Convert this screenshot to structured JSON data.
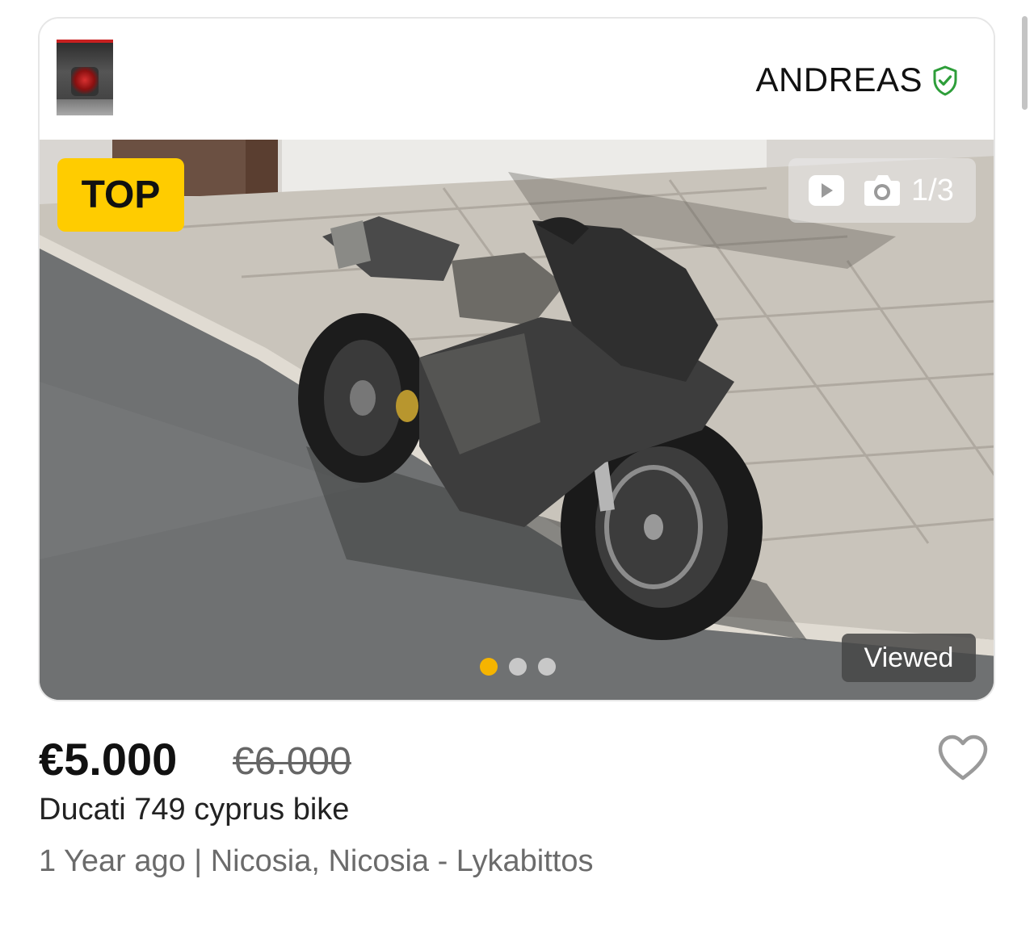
{
  "seller": {
    "name": "ANDREAS",
    "verified_icon": "verified-shield-icon",
    "avatar_icon": "seller-avatar"
  },
  "listing": {
    "badge": "TOP",
    "photo_counter": "1/3",
    "video_icon": "video-play-icon",
    "camera_icon": "camera-icon",
    "viewed_label": "Viewed",
    "carousel_total": 3,
    "carousel_active_index": 0,
    "price_current": "€5.000",
    "price_old": "€6.000",
    "title": "Ducati 749 cyprus bike",
    "meta": "1 Year ago | Nicosia, Nicosia - Lykabittos",
    "favorite_icon": "heart-icon"
  },
  "colors": {
    "badge": "#ffcc00",
    "active_dot": "#f5b400",
    "verified": "#2e9e3a"
  }
}
